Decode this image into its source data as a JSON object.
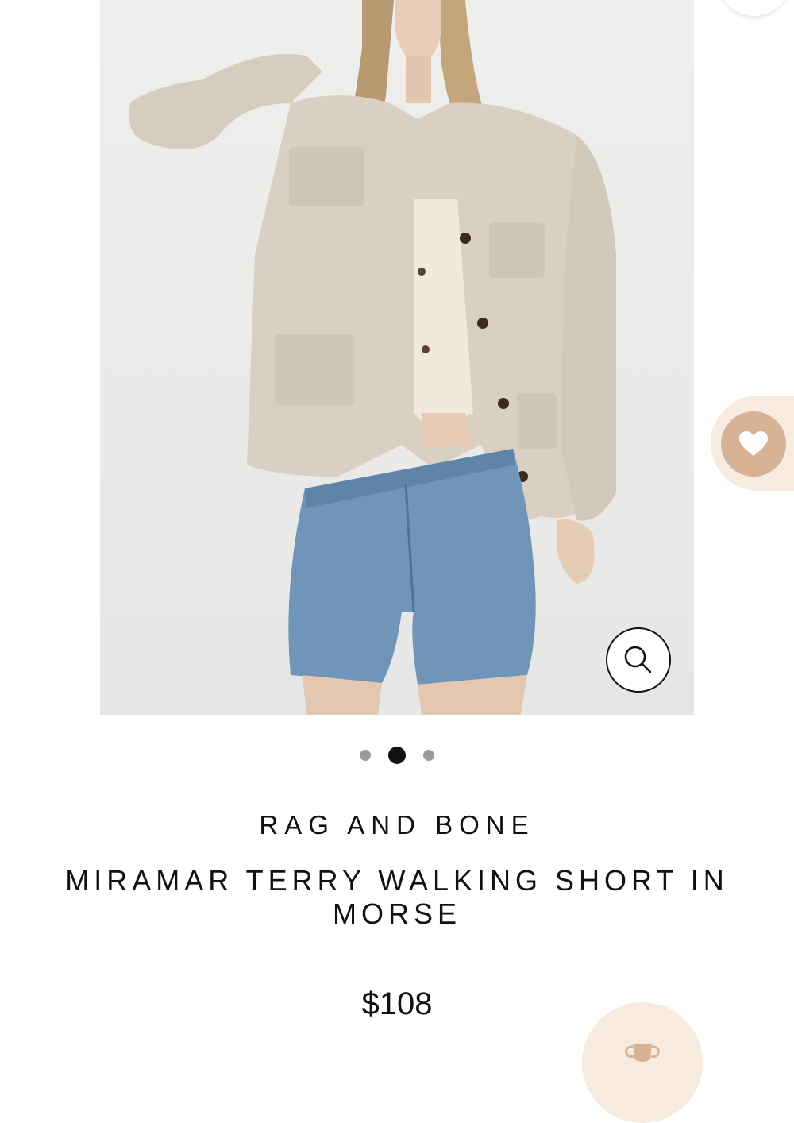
{
  "product": {
    "brand": "RAG AND BONE",
    "title": "MIRAMAR TERRY WALKING SHORT IN MORSE",
    "price": "$108",
    "image_alt": "model-wearing-jacket-and-denim-shorts"
  },
  "carousel": {
    "total_slides": 3,
    "active_slide": 2
  },
  "icons": {
    "zoom": "search-icon",
    "wishlist": "heart-icon",
    "rewards": "trophy-icon"
  },
  "colors": {
    "text": "#111111",
    "dot_inactive": "#9a9a9a",
    "dot_active": "#111111",
    "wishlist_bg": "#d8b294",
    "wishlist_tab": "#f7ebe0",
    "rewards_bg": "#f7ebe0"
  }
}
